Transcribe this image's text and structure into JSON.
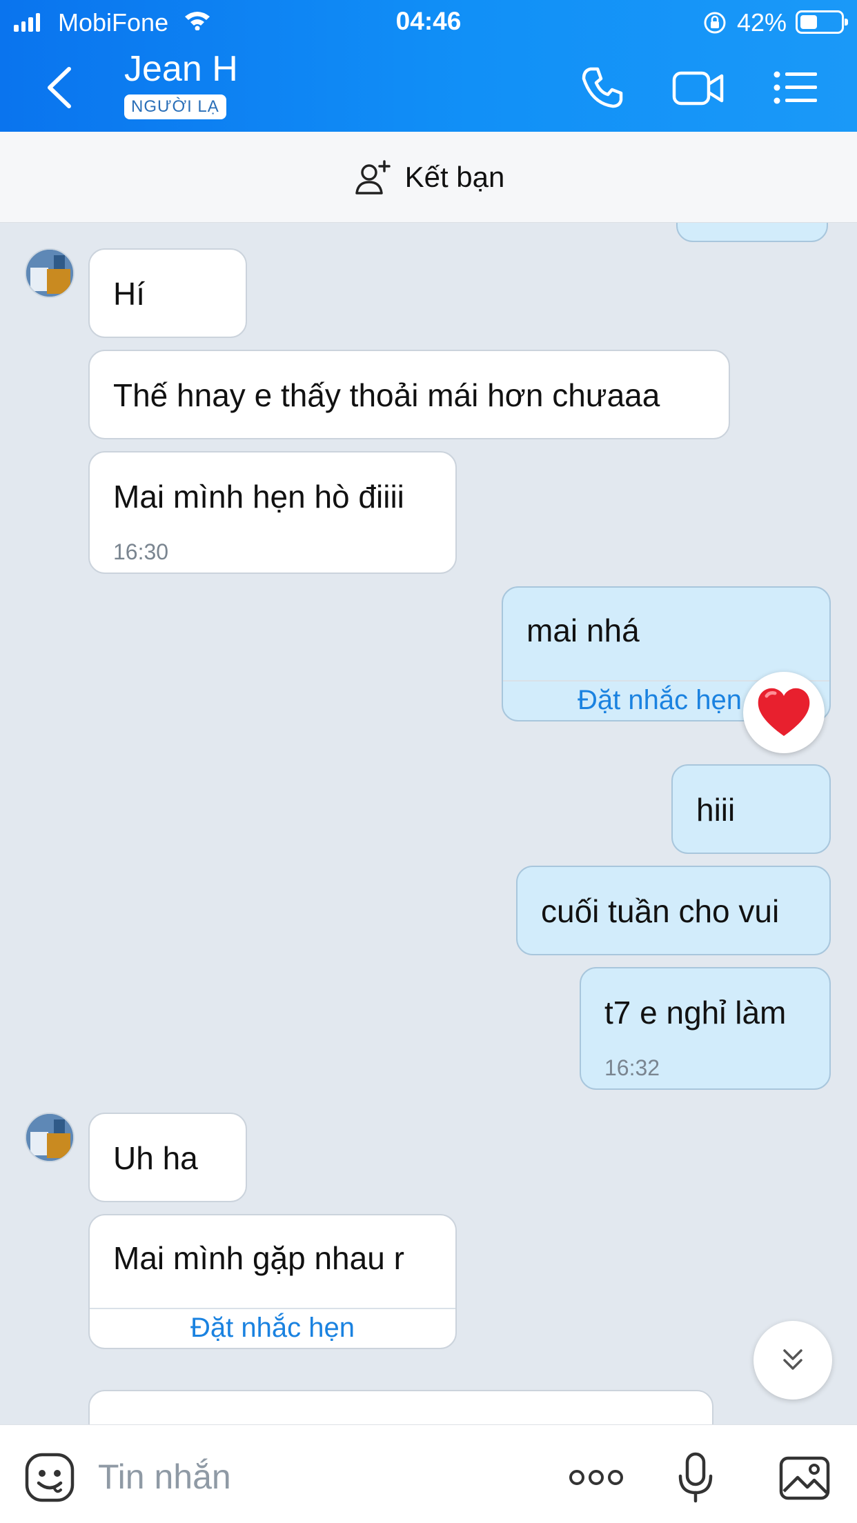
{
  "status_bar": {
    "carrier": "MobiFone",
    "time": "04:46",
    "battery": "42%"
  },
  "header": {
    "contact_name": "Jean H",
    "badge": "NGƯỜI LẠ",
    "icons": [
      "back-chevron-icon",
      "phone-icon",
      "video-camera-icon",
      "menu-list-icon"
    ]
  },
  "add_friend": {
    "label": "Kết bạn",
    "icon": "add-person-icon"
  },
  "messages": {
    "m1": "Hí",
    "m2": "Thế hnay e thấy thoải mái hơn chưaaa",
    "m3": "Mai mình hẹn hò điiii",
    "m3_time": "16:30",
    "m4": "mai nhá",
    "m4_action": "Đặt nhắc hẹn",
    "m4_reaction": "heart",
    "m5": "hiii",
    "m6": "cuối tuần cho vui",
    "m7": "t7 e nghỉ làm",
    "m7_time": "16:32",
    "m8": "Uh ha",
    "m9": "Mai mình gặp nhau r",
    "m9_action": "Đặt nhắc hẹn"
  },
  "composer": {
    "placeholder": "Tin nhắn",
    "icons": [
      "sticker-icon",
      "more-dots-icon",
      "microphone-icon",
      "image-gallery-icon"
    ]
  },
  "colors": {
    "header_blue": "#0a74ee",
    "chat_bg": "#e2e8ef",
    "my_bubble": "#d2ecfb",
    "link_blue": "#1a82e0"
  }
}
